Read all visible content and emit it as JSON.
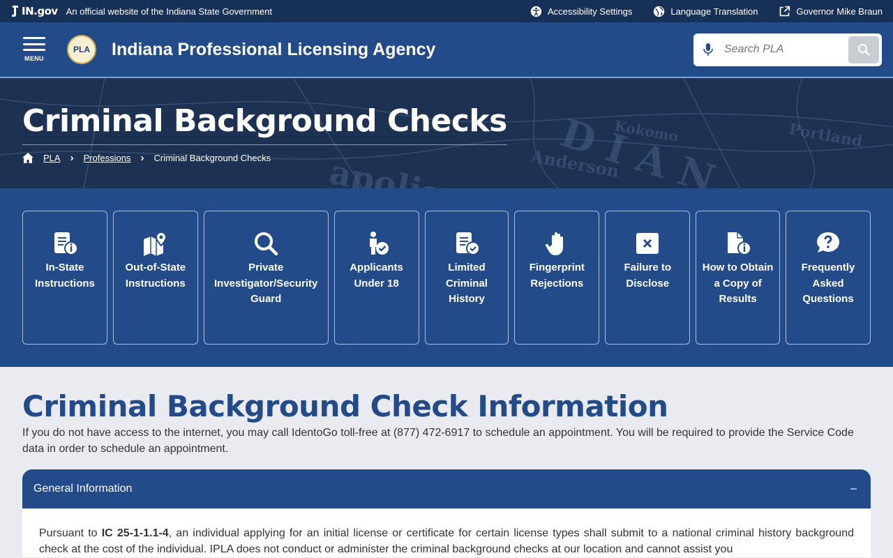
{
  "topbar": {
    "logo": "IN.gov",
    "official_text": "An official website of the Indiana State Government",
    "links": [
      {
        "label": "Accessibility Settings",
        "icon": "accessibility-icon"
      },
      {
        "label": "Language Translation",
        "icon": "globe-icon"
      },
      {
        "label": "Governor Mike Braun",
        "icon": "external-link-icon"
      }
    ]
  },
  "header": {
    "menu_label": "MENU",
    "seal_text": "PLA",
    "agency_name": "Indiana Professional Licensing Agency",
    "search_placeholder": "Search PLA"
  },
  "hero": {
    "title": "Criminal Background Checks",
    "breadcrumbs": [
      "PLA",
      "Professions",
      "Criminal Background Checks"
    ]
  },
  "tiles": [
    {
      "label": "In-State Instructions",
      "icon": "document-info-icon"
    },
    {
      "label": "Out-of-State Instructions",
      "icon": "map-pin-icon"
    },
    {
      "label": "Private Investigator/Security Guard",
      "icon": "search-icon"
    },
    {
      "label": "Applicants Under 18",
      "icon": "person-check-icon"
    },
    {
      "label": "Limited Criminal History",
      "icon": "document-check-icon"
    },
    {
      "label": "Fingerprint Rejections",
      "icon": "hand-icon"
    },
    {
      "label": "Failure to Disclose",
      "icon": "x-box-icon"
    },
    {
      "label": "How to Obtain a Copy of Results",
      "icon": "file-info-icon"
    },
    {
      "label": "Frequently Asked Questions",
      "icon": "question-bubble-icon"
    }
  ],
  "content": {
    "heading": "Criminal Background Check Information",
    "intro": "If you do not have access to the internet, you may call IdentoGo toll-free at (877) 472-6917 to schedule an appointment. You will be required to provide the Service Code data in order to schedule an appointment.",
    "accordion": {
      "title": "General Information",
      "toggle": "–",
      "body_prefix": "Pursuant to ",
      "body_bold": "IC 25-1-1.1-4",
      "body_rest": ", an individual applying for an initial license or certificate for certain license types shall submit to a national criminal history background check at the cost of the individual. IPLA does not conduct or administer the criminal background checks at our location and cannot assist you"
    }
  },
  "colors": {
    "topbar": "#173058",
    "primary": "#234b89",
    "page_bg": "#e9ebf1"
  }
}
